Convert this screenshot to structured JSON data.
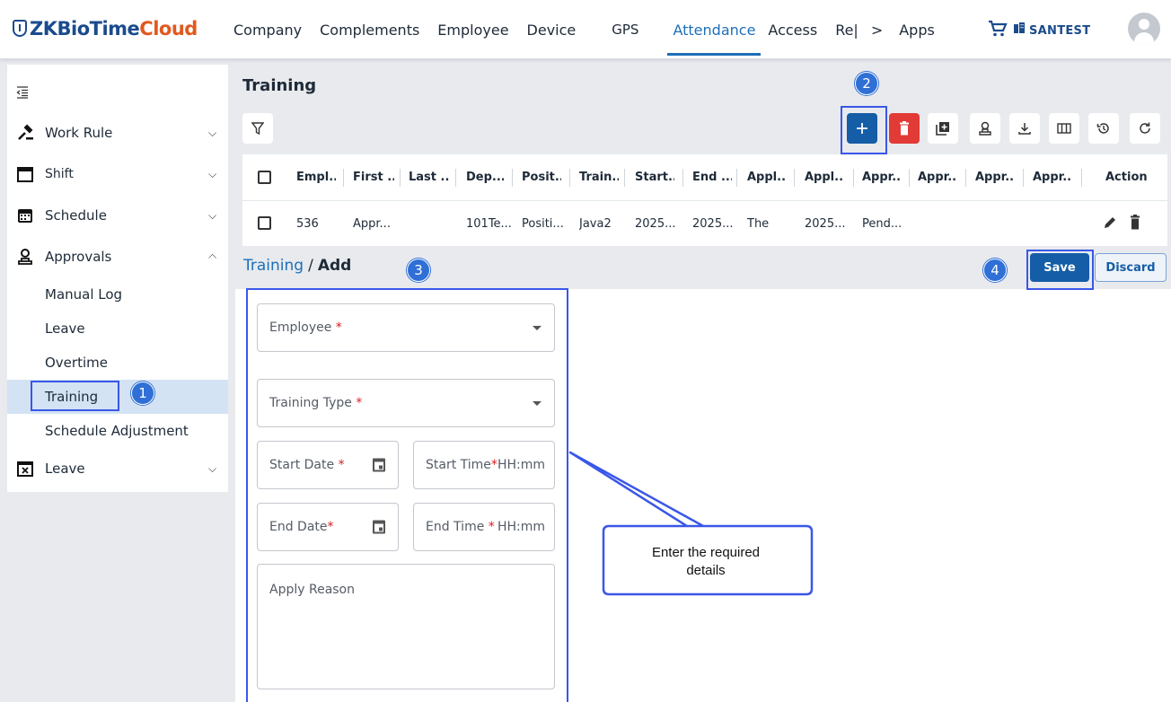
{
  "app": {
    "brand_part1": "ZKBioTime",
    "brand_part2": "Cloud",
    "brand_color": "#1a4b8c",
    "accent_color": "#e2581f"
  },
  "nav": {
    "items": [
      "Company",
      "Complements",
      "Employee",
      "Device",
      "GPS",
      "Attendance",
      "Access",
      "Re|",
      "Apps"
    ],
    "active": "Attendance",
    "more_chevron": ">",
    "company": "SANTEST"
  },
  "sidebar": {
    "items": [
      {
        "label": "Work Rule",
        "icon": "gavel-icon",
        "chevron": "v"
      },
      {
        "label": "Shift",
        "icon": "calendar-icon",
        "chevron": "v"
      },
      {
        "label": "Schedule",
        "icon": "calendar-grid-icon",
        "chevron": "v"
      },
      {
        "label": "Approvals",
        "icon": "stamp-icon",
        "chevron": "^"
      }
    ],
    "approvals_sub": [
      "Manual Log",
      "Leave",
      "Overtime",
      "Training",
      "Schedule Adjustment"
    ],
    "active_sub": "Training",
    "leave": {
      "label": "Leave",
      "icon": "calendar-x-icon",
      "chevron": "v"
    }
  },
  "page": {
    "title": "Training"
  },
  "table": {
    "headers": [
      "Empl...",
      "First ...",
      "Last ...",
      "Dep...",
      "Posit...",
      "Train...",
      "Start...",
      "End ...",
      "Appl...",
      "Appl...",
      "Appr...",
      "Appr...",
      "Appr...",
      "Appr...",
      "Action"
    ],
    "row": [
      "536",
      "Appr...",
      "",
      "101Te...",
      "Positi...",
      "Java2",
      "2025...",
      "2025...",
      "The",
      "2025...",
      "Pend...",
      "",
      "",
      ""
    ]
  },
  "form": {
    "breadcrumb_parent": "Training",
    "breadcrumb_sep": "/",
    "breadcrumb_current": "Add",
    "save_label": "Save",
    "discard_label": "Discard",
    "employee_label": "Employee",
    "training_type_label": "Training Type",
    "start_date_label": "Start Date",
    "start_time_label": "Start Time",
    "start_time_placeholder": "HH:mm",
    "end_date_label": "End Date",
    "end_time_label": "End Time",
    "end_time_placeholder": "HH:mm",
    "apply_reason_label": "Apply Reason",
    "required_mark": "*"
  },
  "annotations": {
    "steps": [
      "1",
      "2",
      "3",
      "4"
    ],
    "callout_line1": "Enter the required",
    "callout_line2": "details",
    "highlight_color": "#3a57e8"
  }
}
